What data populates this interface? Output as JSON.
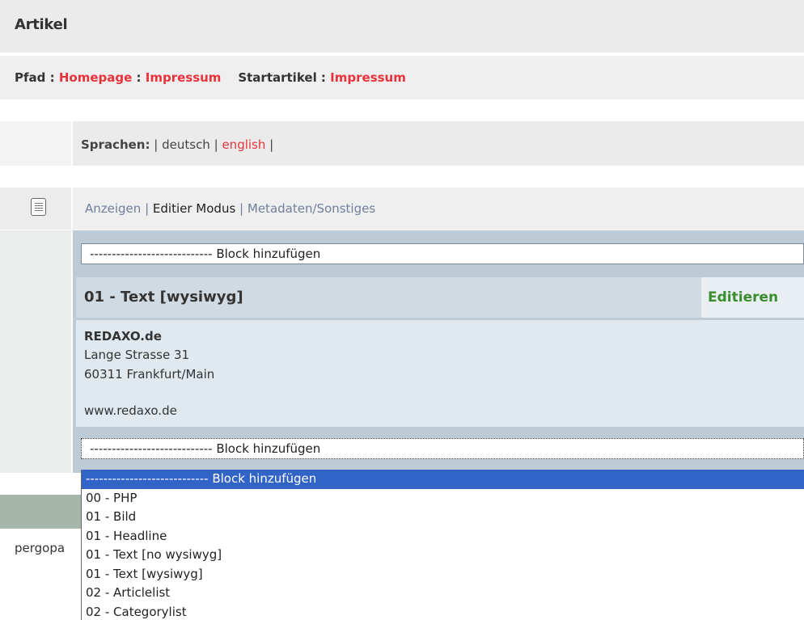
{
  "header": {
    "title": "Artikel"
  },
  "path": {
    "label": "Pfad :",
    "homepage": "Homepage",
    "sep": ":",
    "current": "Impressum",
    "start_label": "Startartikel :",
    "start_value": "Impressum"
  },
  "languages": {
    "label": "Sprachen:",
    "sep1": "|",
    "deutsch": "deutsch",
    "sep2": "|",
    "english": "english",
    "sep3": "|"
  },
  "modes": {
    "show": "Anzeigen",
    "sep1": "|",
    "edit": "Editier Modus",
    "sep2": "|",
    "meta": "Metadaten/Sonstiges"
  },
  "block_select": {
    "value": "---------------------------- Block hinzufügen"
  },
  "slice": {
    "title": "01 - Text [wysiwyg]",
    "edit_label": "Editieren",
    "company": "REDAXO.de",
    "street": "Lange Strasse 31",
    "city": "60311 Frankfurt/Main",
    "url": "www.redaxo.de"
  },
  "block_select_2": {
    "value": "---------------------------- Block hinzufügen"
  },
  "footer": {
    "text": "pergopa"
  },
  "dropdown": {
    "options": [
      "---------------------------- Block hinzufügen",
      "00 - PHP",
      "01 - Bild",
      "01 - Headline",
      "01 - Text [no wysiwyg]",
      "01 - Text [wysiwyg]",
      "02 - Articlelist",
      "02 - Categorylist"
    ],
    "selected_index": 0
  },
  "colors": {
    "link_red": "#e8333b",
    "edit_green": "#3a8d2f",
    "selected_blue": "#3264c8"
  },
  "icons": {
    "mode": "document-icon"
  }
}
